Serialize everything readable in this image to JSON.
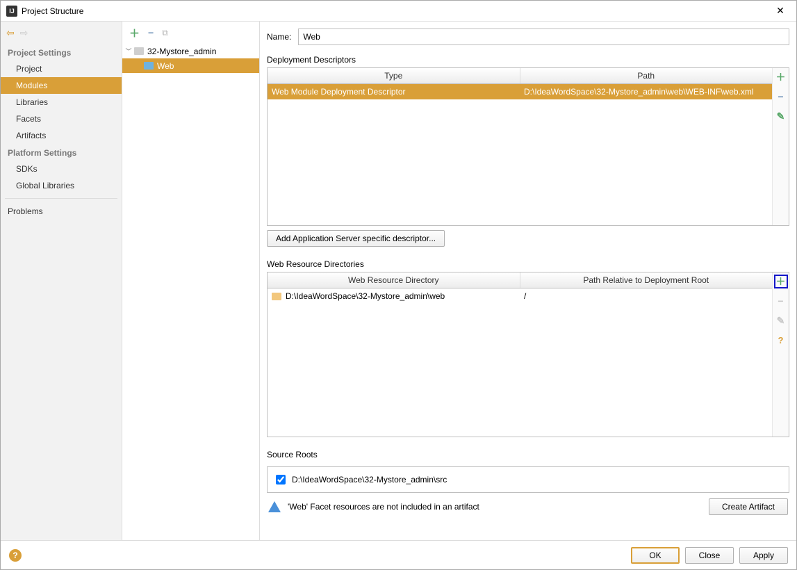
{
  "window": {
    "title": "Project Structure"
  },
  "nav": {
    "heading1": "Project Settings",
    "heading2": "Platform Settings",
    "items1": [
      "Project",
      "Modules",
      "Libraries",
      "Facets",
      "Artifacts"
    ],
    "items2": [
      "SDKs",
      "Global Libraries"
    ],
    "problems": "Problems",
    "selected": "Modules"
  },
  "tree": {
    "root": "32-Mystore_admin",
    "child": "Web"
  },
  "form": {
    "name_label": "Name:",
    "name_value": "Web"
  },
  "descriptors": {
    "section": "Deployment Descriptors",
    "col_type": "Type",
    "col_path": "Path",
    "rows": [
      {
        "type": "Web Module Deployment Descriptor",
        "path": "D:\\IdeaWordSpace\\32-Mystore_admin\\web\\WEB-INF\\web.xml"
      }
    ],
    "add_btn": "Add Application Server specific descriptor..."
  },
  "resources": {
    "section": "Web Resource Directories",
    "col_dir": "Web Resource Directory",
    "col_rel": "Path Relative to Deployment Root",
    "rows": [
      {
        "dir": "D:\\IdeaWordSpace\\32-Mystore_admin\\web",
        "rel": "/"
      }
    ]
  },
  "source": {
    "section": "Source Roots",
    "path": "D:\\IdeaWordSpace\\32-Mystore_admin\\src"
  },
  "warning": {
    "msg": "'Web' Facet resources are not included in an artifact",
    "btn": "Create Artifact"
  },
  "footer": {
    "ok": "OK",
    "close": "Close",
    "apply": "Apply"
  }
}
